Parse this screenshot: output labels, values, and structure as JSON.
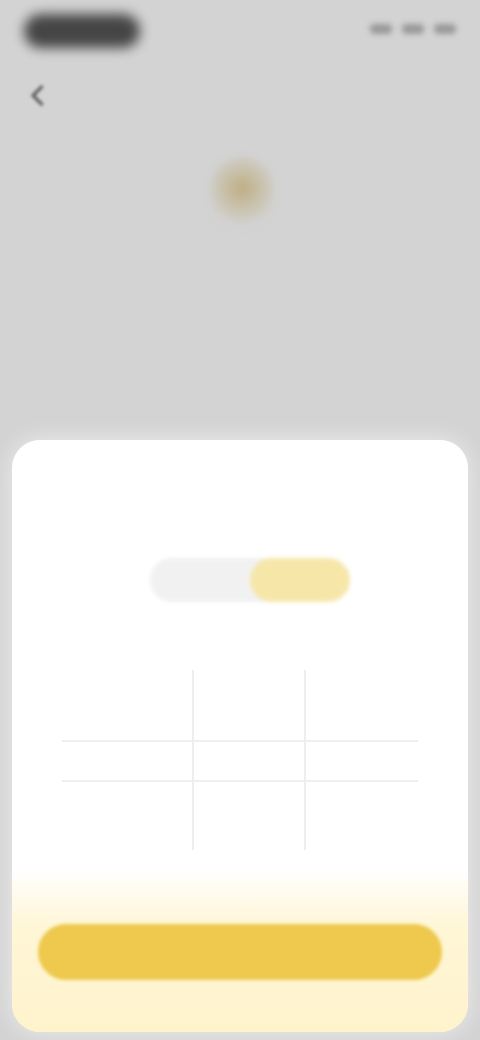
{
  "status_bar": {
    "time": "",
    "indicators": [
      "signal-icon",
      "wifi-icon",
      "battery-icon"
    ]
  },
  "nav": {
    "back_icon": "chevron-left-icon",
    "title": ""
  },
  "hero": {
    "icon": "shield-icon",
    "title": "",
    "subtitle": ""
  },
  "sheet": {
    "title": "",
    "toggle": {
      "options": [
        "",
        ""
      ],
      "selected_index": 1
    },
    "picker": {
      "columns": [
        "",
        ""
      ]
    },
    "primary_button_label": ""
  },
  "colors": {
    "accent": "#eec94d",
    "accent_soft": "#f6e7a9",
    "background": "#d3d3d3",
    "sheet": "#ffffff"
  }
}
